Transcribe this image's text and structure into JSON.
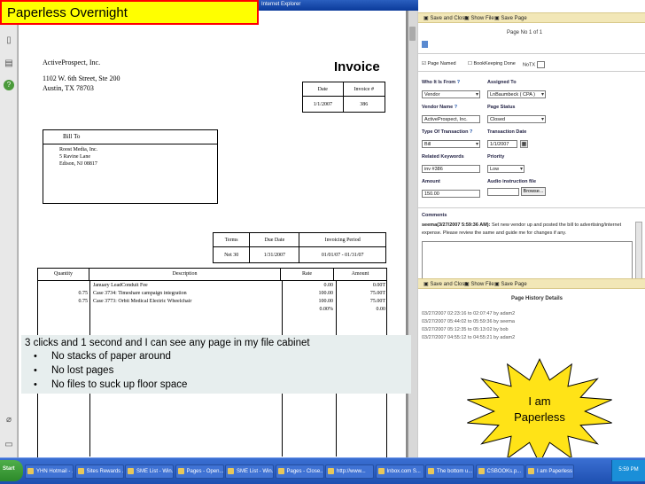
{
  "banner": {
    "title": "Paperless Overnight"
  },
  "ie_title": "Internet Explorer",
  "invoice": {
    "company": "ActiveProspect, Inc.",
    "address1": "1102 W. 6th Street, Ste 200",
    "address2": "Austin, TX 78703",
    "heading": "Invoice",
    "date_label": "Date",
    "invoice_no_label": "Invoice #",
    "date": "1/1/2007",
    "invoice_no": "386",
    "bill_to_label": "Bill To",
    "bill_to": [
      "Roost Media, Inc.",
      "5 Ravine Lane",
      "Edison, NJ 08817"
    ],
    "terms_label": "Terms",
    "due_label": "Due Date",
    "period_label": "Invoicing Period",
    "terms": "Net 30",
    "due": "1/31/2007",
    "period": "01/01/07 - 01/31/07",
    "cols": [
      "Quantity",
      "Description",
      "Rate",
      "Amount"
    ],
    "rows": [
      {
        "qty": "",
        "desc": "January LeadConduit Fee",
        "rate": "0.00",
        "amount": "0.00T"
      },
      {
        "qty": "0.75",
        "desc": "Case 3734: Timeshare campaign integration",
        "rate": "100.00",
        "amount": "75.00T"
      },
      {
        "qty": "0.75",
        "desc": "Case 3773: Orbit Medical Electric Wheelchair",
        "rate": "100.00",
        "amount": "75.00T"
      },
      {
        "qty": "",
        "desc": "",
        "rate": "0.00%",
        "amount": "0.00"
      }
    ]
  },
  "note": {
    "headline": "3 clicks and 1 second and I can see any page in my file cabinet",
    "bullets": [
      "No stacks of paper around",
      "No lost pages",
      "No files to suck up floor space"
    ]
  },
  "star": {
    "line1": "I am",
    "line2": "Paperless",
    "color": "#ffe317"
  },
  "panel": {
    "save_close": "Save and Close",
    "show_file": "Show File",
    "save_page": "Save Page",
    "page_no": "Page No 1 of 1",
    "page_named": "Page Named",
    "bookkeeping": "BookKeeping Done",
    "notx": "NoTX",
    "who_from_label": "Who It Is From",
    "who_from": "Vendor",
    "assigned_label": "Assigned To",
    "assigned": "LnBaumbeck ( CPA )",
    "vendor_label": "Vendor Name",
    "vendor": "ActiveProspect, Inc.",
    "status_label": "Page Status",
    "status": "Closed",
    "type_label": "Type Of Transaction",
    "type": "Bill",
    "tdate_label": "Transaction Date",
    "tdate": "1/1/2007",
    "keywords_label": "Related Keywords",
    "keywords": "inv #386",
    "priority_label": "Priority",
    "priority": "Low",
    "amount_label": "Amount",
    "amount": "150.00",
    "audio_label": "Audio instruction file",
    "browse": "Browse...",
    "comments_label": "Comments",
    "comment_author": "seema(3/27/2007 5:59:36 AM):",
    "comment_text": "Set new vendor up and posted the bill to advertising/internet expense. Please review the same and guide me for changes if any.",
    "history_label": "Page History Details",
    "history": [
      "03/27/2007 02:23:16 to 02:07:47 by adam2",
      "03/27/2007 05:44:02 to 05:59:36 by seema",
      "03/27/2007 05:12:35 to 05:13:02 by bob",
      "03/27/2007 04:55:12 to 04:55:21 by adam2"
    ]
  },
  "taskbar": {
    "start": "Start",
    "items": [
      "YHN Hotmail - ...",
      "Sites Rewards ...",
      "SME List - Win...",
      "Pages - Open...",
      "SME List - Win...",
      "Pages - Close...",
      "http://www...",
      "Inbox.com S...",
      "The bottom u...",
      "CSBOOKs.p...",
      "I am Paperless"
    ],
    "clock": "5:59 PM"
  }
}
